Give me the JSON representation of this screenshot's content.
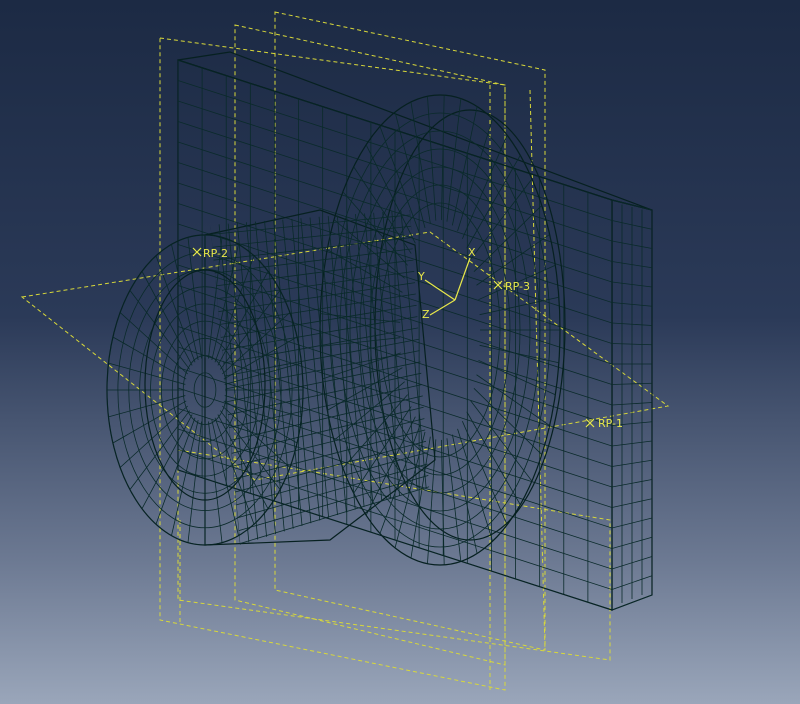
{
  "viewport": {
    "background_top": "#1c2a44",
    "background_bottom": "#9aa6ba",
    "mesh_color": "#21e6e0",
    "mesh_shade": "#1bc8c2",
    "datum_color": "#d8d83a"
  },
  "reference_points": [
    {
      "label": "RP-2"
    },
    {
      "label": "RP-3"
    },
    {
      "label": "RP-1"
    }
  ],
  "triad": {
    "x_label": "X",
    "y_label": "Y",
    "z_label": "Z"
  }
}
